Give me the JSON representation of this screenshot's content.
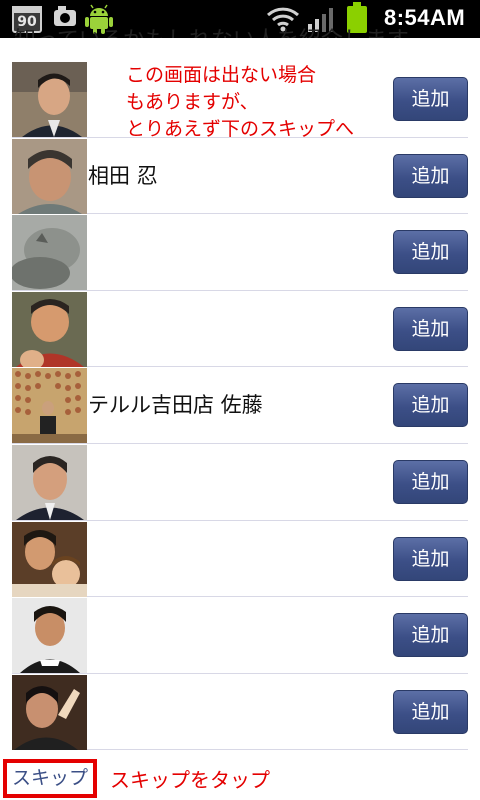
{
  "status_bar": {
    "calendar_day": "90",
    "time": "8:54AM",
    "icons": [
      "calendar-icon",
      "camera-icon",
      "android-icon",
      "wifi-icon",
      "signal-icon",
      "battery-icon"
    ]
  },
  "header_partial": "知っているかもしれない人を紹介します。",
  "friends": [
    {
      "name": "",
      "add_label": "追加"
    },
    {
      "name": "相田 忍",
      "add_label": "追加"
    },
    {
      "name": "",
      "add_label": "追加"
    },
    {
      "name": "",
      "add_label": "追加"
    },
    {
      "name": "テルル吉田店 佐藤",
      "add_label": "追加"
    },
    {
      "name": "",
      "add_label": "追加"
    },
    {
      "name": "",
      "add_label": "追加"
    },
    {
      "name": "",
      "add_label": "追加"
    },
    {
      "name": "",
      "add_label": "追加"
    }
  ],
  "annotation": {
    "lines": [
      "この画面は出ない場合",
      "もありますが、",
      "とりあえず下のスキップへ"
    ]
  },
  "skip": {
    "label": "スキップ",
    "note": "スキップをタップ"
  },
  "colors": {
    "button": "#3c4f87",
    "annotation": "#e40000",
    "battery": "#8bd000"
  }
}
